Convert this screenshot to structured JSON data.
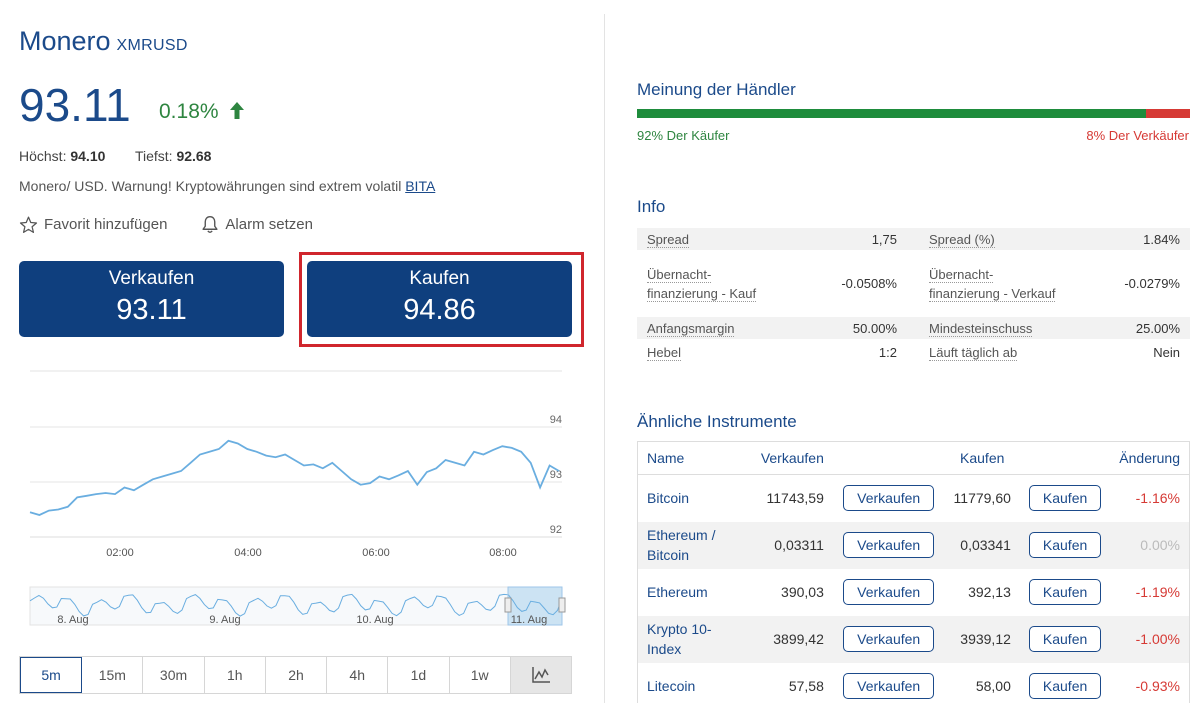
{
  "instrument": {
    "name": "Monero",
    "symbol": "XMRUSD",
    "price": "93.11",
    "change": "0.18%",
    "high_label": "Höchst:",
    "high": "94.10",
    "low_label": "Tiefst:",
    "low": "92.68",
    "description": "Monero/ USD. Warnung! Kryptowährungen sind extrem volatil",
    "description_link": "BITA",
    "favorite_label": "Favorit hinzufügen",
    "alarm_label": "Alarm setzen",
    "sell": {
      "label": "Verkaufen",
      "price": "93.11"
    },
    "buy": {
      "label": "Kaufen",
      "price": "94.86"
    }
  },
  "colors": {
    "brand": "#0f3f7e",
    "positive": "#2e8540",
    "negative": "#d63a35",
    "highlight": "#d0262d",
    "line": "#6aaee0"
  },
  "chart_data": {
    "type": "line",
    "x_ticks": [
      "02:00",
      "04:00",
      "06:00",
      "08:00"
    ],
    "y_ticks": [
      "94",
      "93",
      "92"
    ],
    "ylim": [
      92,
      94
    ],
    "grid": true,
    "series": [
      {
        "values": [
          92.45,
          92.4,
          92.48,
          92.5,
          92.55,
          92.72,
          92.75,
          92.78,
          92.8,
          92.78,
          92.9,
          92.85,
          92.95,
          93.05,
          93.1,
          93.15,
          93.2,
          93.35,
          93.5,
          93.55,
          93.6,
          93.75,
          93.7,
          93.6,
          93.55,
          93.48,
          93.45,
          93.5,
          93.4,
          93.3,
          93.32,
          93.25,
          93.35,
          93.2,
          93.05,
          92.95,
          92.98,
          93.1,
          93.05,
          93.12,
          93.2,
          92.95,
          93.18,
          93.25,
          93.4,
          93.35,
          93.3,
          93.55,
          93.5,
          93.58,
          93.65,
          93.62,
          93.55,
          93.35,
          92.9,
          93.3,
          93.2
        ]
      }
    ],
    "navigator": {
      "labels": [
        "8. Aug",
        "9. Aug",
        "10. Aug",
        "11. Aug"
      ]
    }
  },
  "ranges": [
    "5m",
    "15m",
    "30m",
    "1h",
    "2h",
    "4h",
    "1d",
    "1w"
  ],
  "active_range": "5m",
  "sentiment": {
    "title": "Meinung der Händler",
    "buyers_pct": 92,
    "buyers_label": "92% Der Käufer",
    "sellers_label": "8% Der Verkäufer"
  },
  "info": {
    "title": "Info",
    "rows": [
      {
        "l1": "Spread",
        "v1": "1,75",
        "l2": "Spread (%)",
        "v2": "1.84%"
      },
      {
        "l1": "Übernacht-finanzierung - Kauf",
        "v1": "-0.0508%",
        "l2": "Übernacht-finanzierung - Verkauf",
        "v2": "-0.0279%"
      },
      {
        "l1": "Anfangsmargin",
        "v1": "50.00%",
        "l2": "Mindesteinschuss",
        "v2": "25.00%"
      },
      {
        "l1": "Hebel",
        "v1": "1:2",
        "l2": "Läuft täglich ab",
        "v2": "Nein"
      }
    ]
  },
  "similar": {
    "title": "Ähnliche Instrumente",
    "headers": {
      "name": "Name",
      "sell": "Verkaufen",
      "buy": "Kaufen",
      "change": "Änderung"
    },
    "sell_button": "Verkaufen",
    "buy_button": "Kaufen",
    "rows": [
      {
        "name": "Bitcoin",
        "sell": "11743,59",
        "buy": "11779,60",
        "change": "-1.16%"
      },
      {
        "name": "Ethereum / Bitcoin",
        "sell": "0,03311",
        "buy": "0,03341",
        "change": "0.00%"
      },
      {
        "name": "Ethereum",
        "sell": "390,03",
        "buy": "392,13",
        "change": "-1.19%"
      },
      {
        "name": "Krypto 10-Index",
        "sell": "3899,42",
        "buy": "3939,12",
        "change": "-1.00%"
      },
      {
        "name": "Litecoin",
        "sell": "57,58",
        "buy": "58,00",
        "change": "-0.93%"
      }
    ]
  }
}
